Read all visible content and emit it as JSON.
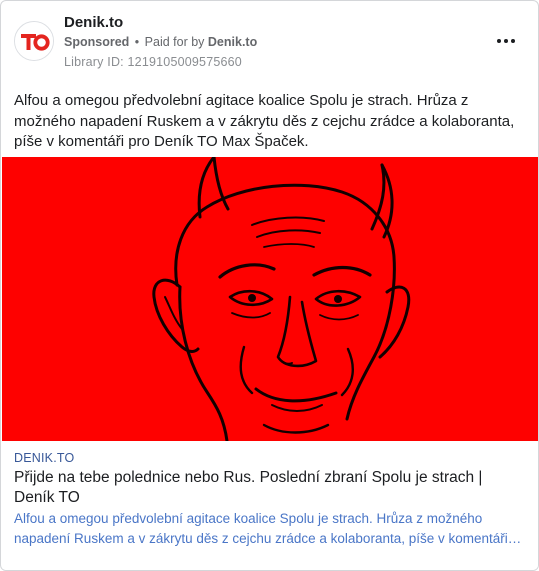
{
  "post": {
    "page_name": "Denik.to",
    "sponsored_label": "Sponsored",
    "separator": "•",
    "paid_for_prefix": "Paid for by",
    "payer": "Denik.to",
    "library_id": "Library ID: 1219105009575660",
    "avatar_logo_text": "TO",
    "avatar_icon": "denik-to-logo",
    "more_icon": "more-options-dots-icon",
    "text": "Alfou a omegou předvolební agitace koalice Spolu je strach. Hrůza z možného napadení Ruskem a v zákrytu děs z cejchu zrádce a kolaboranta, píše v komentáři pro Deník TO Max Špaček."
  },
  "image": {
    "background_color": "#fe0100",
    "line_color": "#120000"
  },
  "link": {
    "domain": "DENIK.TO",
    "title": "Přijde na tebe polednice nebo Rus. Poslední zbraní Spolu je strach | Deník TO",
    "description": "Alfou a omegou předvolební agitace koalice Spolu je strach. Hrůza z možného napadení Ruskem a v zákrytu děs z cejchu zrádce a kolaboranta, píše v komentáři pro Deník TO Max Špaček."
  },
  "colors": {
    "brand_red": "#e4251f",
    "link_blue": "#4a76c7",
    "meta_gray": "#65676b"
  }
}
